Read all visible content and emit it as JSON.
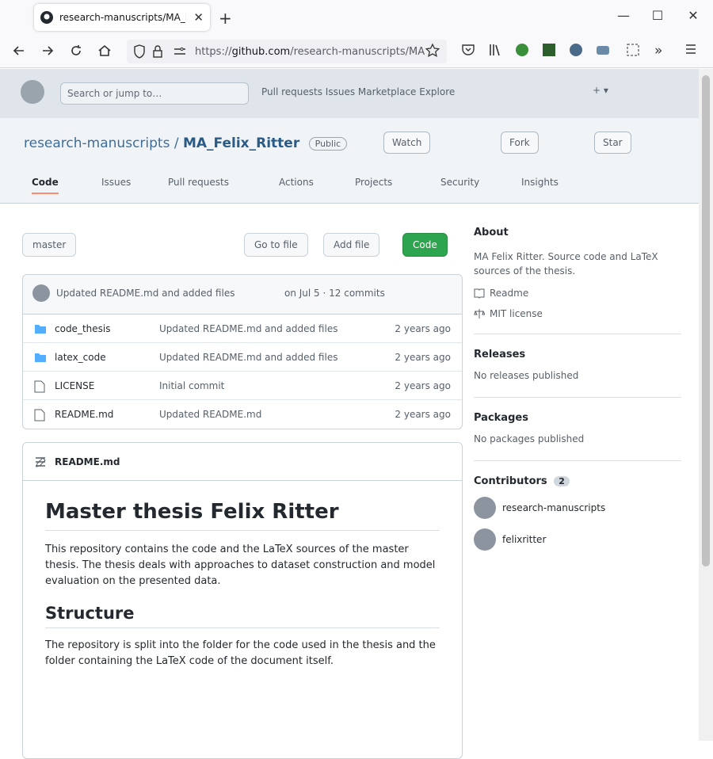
{
  "browser": {
    "tab_title": "research-manuscripts/MA_Felix",
    "url_prefix": "https://",
    "url_host": "github.com",
    "url_path": "/research-manuscripts/MA",
    "new_tab": "+",
    "close": "✕",
    "minimize": "—",
    "maximize": "☐"
  },
  "gh_header": {
    "search_placeholder": "Search or jump to…",
    "nav": "Pull requests   Issues   Marketplace   Explore",
    "user": "+ ▾"
  },
  "repo": {
    "owner": "research-manuscripts",
    "name": "MA_Felix_Ritter",
    "visibility": "Public",
    "actions": [
      "Watch",
      "Fork",
      "Star"
    ],
    "tabs": [
      "Code",
      "Issues",
      "Pull requests",
      "Actions",
      "Projects",
      "Security",
      "Insights"
    ]
  },
  "toolbar": {
    "branch": "master",
    "goto_file": "Go to file",
    "add_file": "Add file",
    "code": "Code"
  },
  "commit": {
    "message": "Updated README.md and added files",
    "meta": "on Jul 5  ·  12 commits"
  },
  "files": [
    {
      "name": "code_thesis",
      "message": "Updated README.md and added files",
      "date": "2 years ago"
    },
    {
      "name": "latex_code",
      "message": "Updated README.md and added files",
      "date": "2 years ago"
    },
    {
      "name": "LICENSE",
      "message": "Initial commit",
      "date": "2 years ago"
    },
    {
      "name": "README.md",
      "message": "Updated README.md",
      "date": "2 years ago"
    }
  ],
  "readme": {
    "label": "README.md",
    "h1": "Master thesis Felix Ritter",
    "p1": "This repository contains the code and the LaTeX sources of the master thesis. The thesis deals with approaches to dataset construction and model evaluation on the presented data.",
    "h2": "Structure",
    "p2": "The repository is split into the folder for the code used in the thesis and the folder containing the LaTeX code of the document itself."
  },
  "sidebar": {
    "about_h": "About",
    "about_t": "MA Felix Ritter. Source code and LaTeX sources of the thesis.",
    "readme": "Readme",
    "license": "MIT license",
    "releases_h": "Releases",
    "releases_t": "No releases published",
    "packages_h": "Packages",
    "packages_t": "No packages published",
    "contributors_h": "Contributors",
    "contributors_count": "2",
    "contributors": [
      "research-manuscripts",
      "felixritter"
    ]
  }
}
